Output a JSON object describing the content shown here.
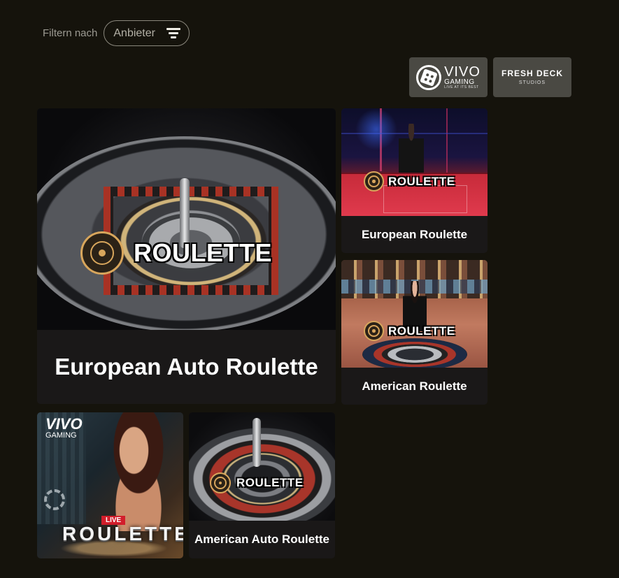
{
  "filter": {
    "label": "Filtern nach",
    "button_label": "Anbieter"
  },
  "providers": [
    {
      "name": "Vivo Gaming",
      "logo_main": "VIVO",
      "logo_sub": "GAMING",
      "logo_tagline": "LIVE AT ITS BEST"
    },
    {
      "name": "Fresh Deck Studios",
      "logo_main": "FRESH DECK",
      "logo_sub": "STUDIOS"
    }
  ],
  "games": [
    {
      "id": "european-auto-roulette",
      "title": "European Auto Roulette",
      "badge": "ROULETTE"
    },
    {
      "id": "european-roulette",
      "title": "European Roulette",
      "badge": "ROULETTE"
    },
    {
      "id": "american-roulette",
      "title": "American Roulette",
      "badge": "ROULETTE"
    },
    {
      "id": "vivo-live-roulette",
      "title": "",
      "art_logo_main": "VIVO",
      "art_logo_sub": "GAMING",
      "art_live": "LIVE",
      "art_title": "ROULETTE"
    },
    {
      "id": "american-auto-roulette",
      "title": "American Auto Roulette",
      "badge": "ROULETTE"
    }
  ],
  "colors": {
    "background": "#15130c",
    "tile": "#1a1818",
    "provider_bg": "#4a4943",
    "accent_gold": "#d8a65c"
  }
}
